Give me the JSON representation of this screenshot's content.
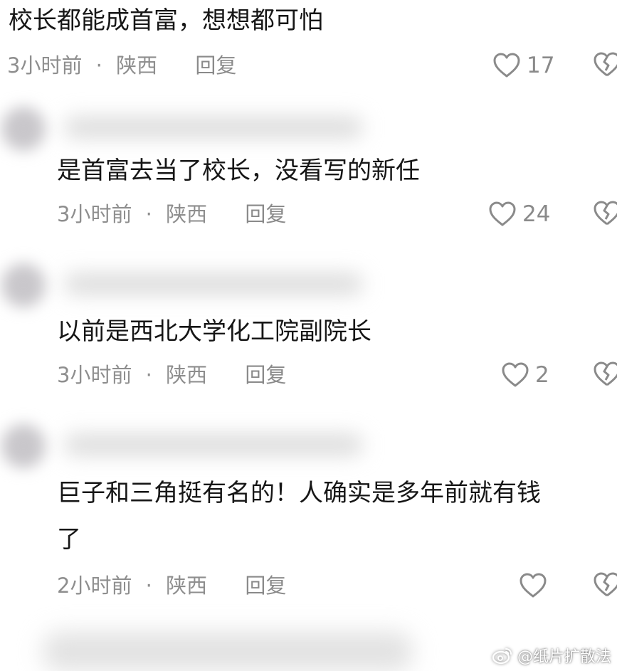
{
  "comments": [
    {
      "text": "校长都能成首富，想想都可怕",
      "time": "3小时前",
      "location": "陕西",
      "reply_label": "回复",
      "likes": "17"
    },
    {
      "text": "是首富去当了校长，没看写的新任",
      "time": "3小时前",
      "location": "陕西",
      "reply_label": "回复",
      "likes": "24"
    },
    {
      "text": "以前是西北大学化工院副院长",
      "time": "3小时前",
      "location": "陕西",
      "reply_label": "回复",
      "likes": "2"
    },
    {
      "text_line1": "巨子和三角挺有名的！人确实是多年前就有钱",
      "text_line2": "了",
      "time": "2小时前",
      "location": "陕西",
      "reply_label": "回复",
      "likes": ""
    }
  ],
  "meta_separator": "·",
  "watermark": {
    "text": "@纸片扩散法",
    "icon": "weibo-logo-icon"
  },
  "icons": {
    "like": "heart-outline-icon",
    "dislike": "broken-heart-icon"
  },
  "colors": {
    "text": "#161616",
    "meta": "#8e8e8e",
    "icon": "#8a8a8a"
  }
}
